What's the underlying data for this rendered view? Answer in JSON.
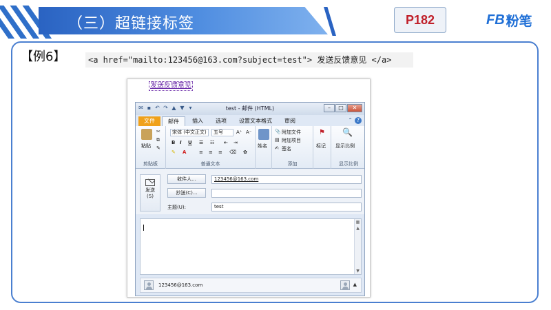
{
  "banner": {
    "title": "（三）超链接标签",
    "page": "P182",
    "logo_mark": "FB",
    "logo_text": "粉笔",
    "accent": "#2f6fc9",
    "page_color": "#c0202a"
  },
  "example": {
    "label": "【例6】",
    "code": "<a href=\"mailto:123456@163.com?subject=test\"> 发送反馈意见 </a>"
  },
  "screenshot": {
    "link_text": "发送反馈意见",
    "window_title": "test - 邮件 (HTML)",
    "tabs": [
      "文件",
      "邮件",
      "插入",
      "选项",
      "设置文本格式",
      "审阅"
    ],
    "ribbon": {
      "paste": "粘贴",
      "clipboard": "剪贴板",
      "font_name": "宋体 (中文正文)",
      "font_size": "五号",
      "basic_text": "普通文本",
      "names": "姓名",
      "attach_file": "附加文件",
      "attach_item": "附加项目",
      "signature": "签名",
      "include": "添加",
      "flag": "标记",
      "zoom": "显示比例",
      "zoom_group": "显示比例"
    },
    "send_label": "发送",
    "send_key": "(S)",
    "to_button": "收件人...",
    "cc_button": "抄送(C)...",
    "subject_label": "主题(U):",
    "to_value": "123456@163.com",
    "cc_value": "",
    "subject_value": "test",
    "people_email": "123456@163.com"
  }
}
